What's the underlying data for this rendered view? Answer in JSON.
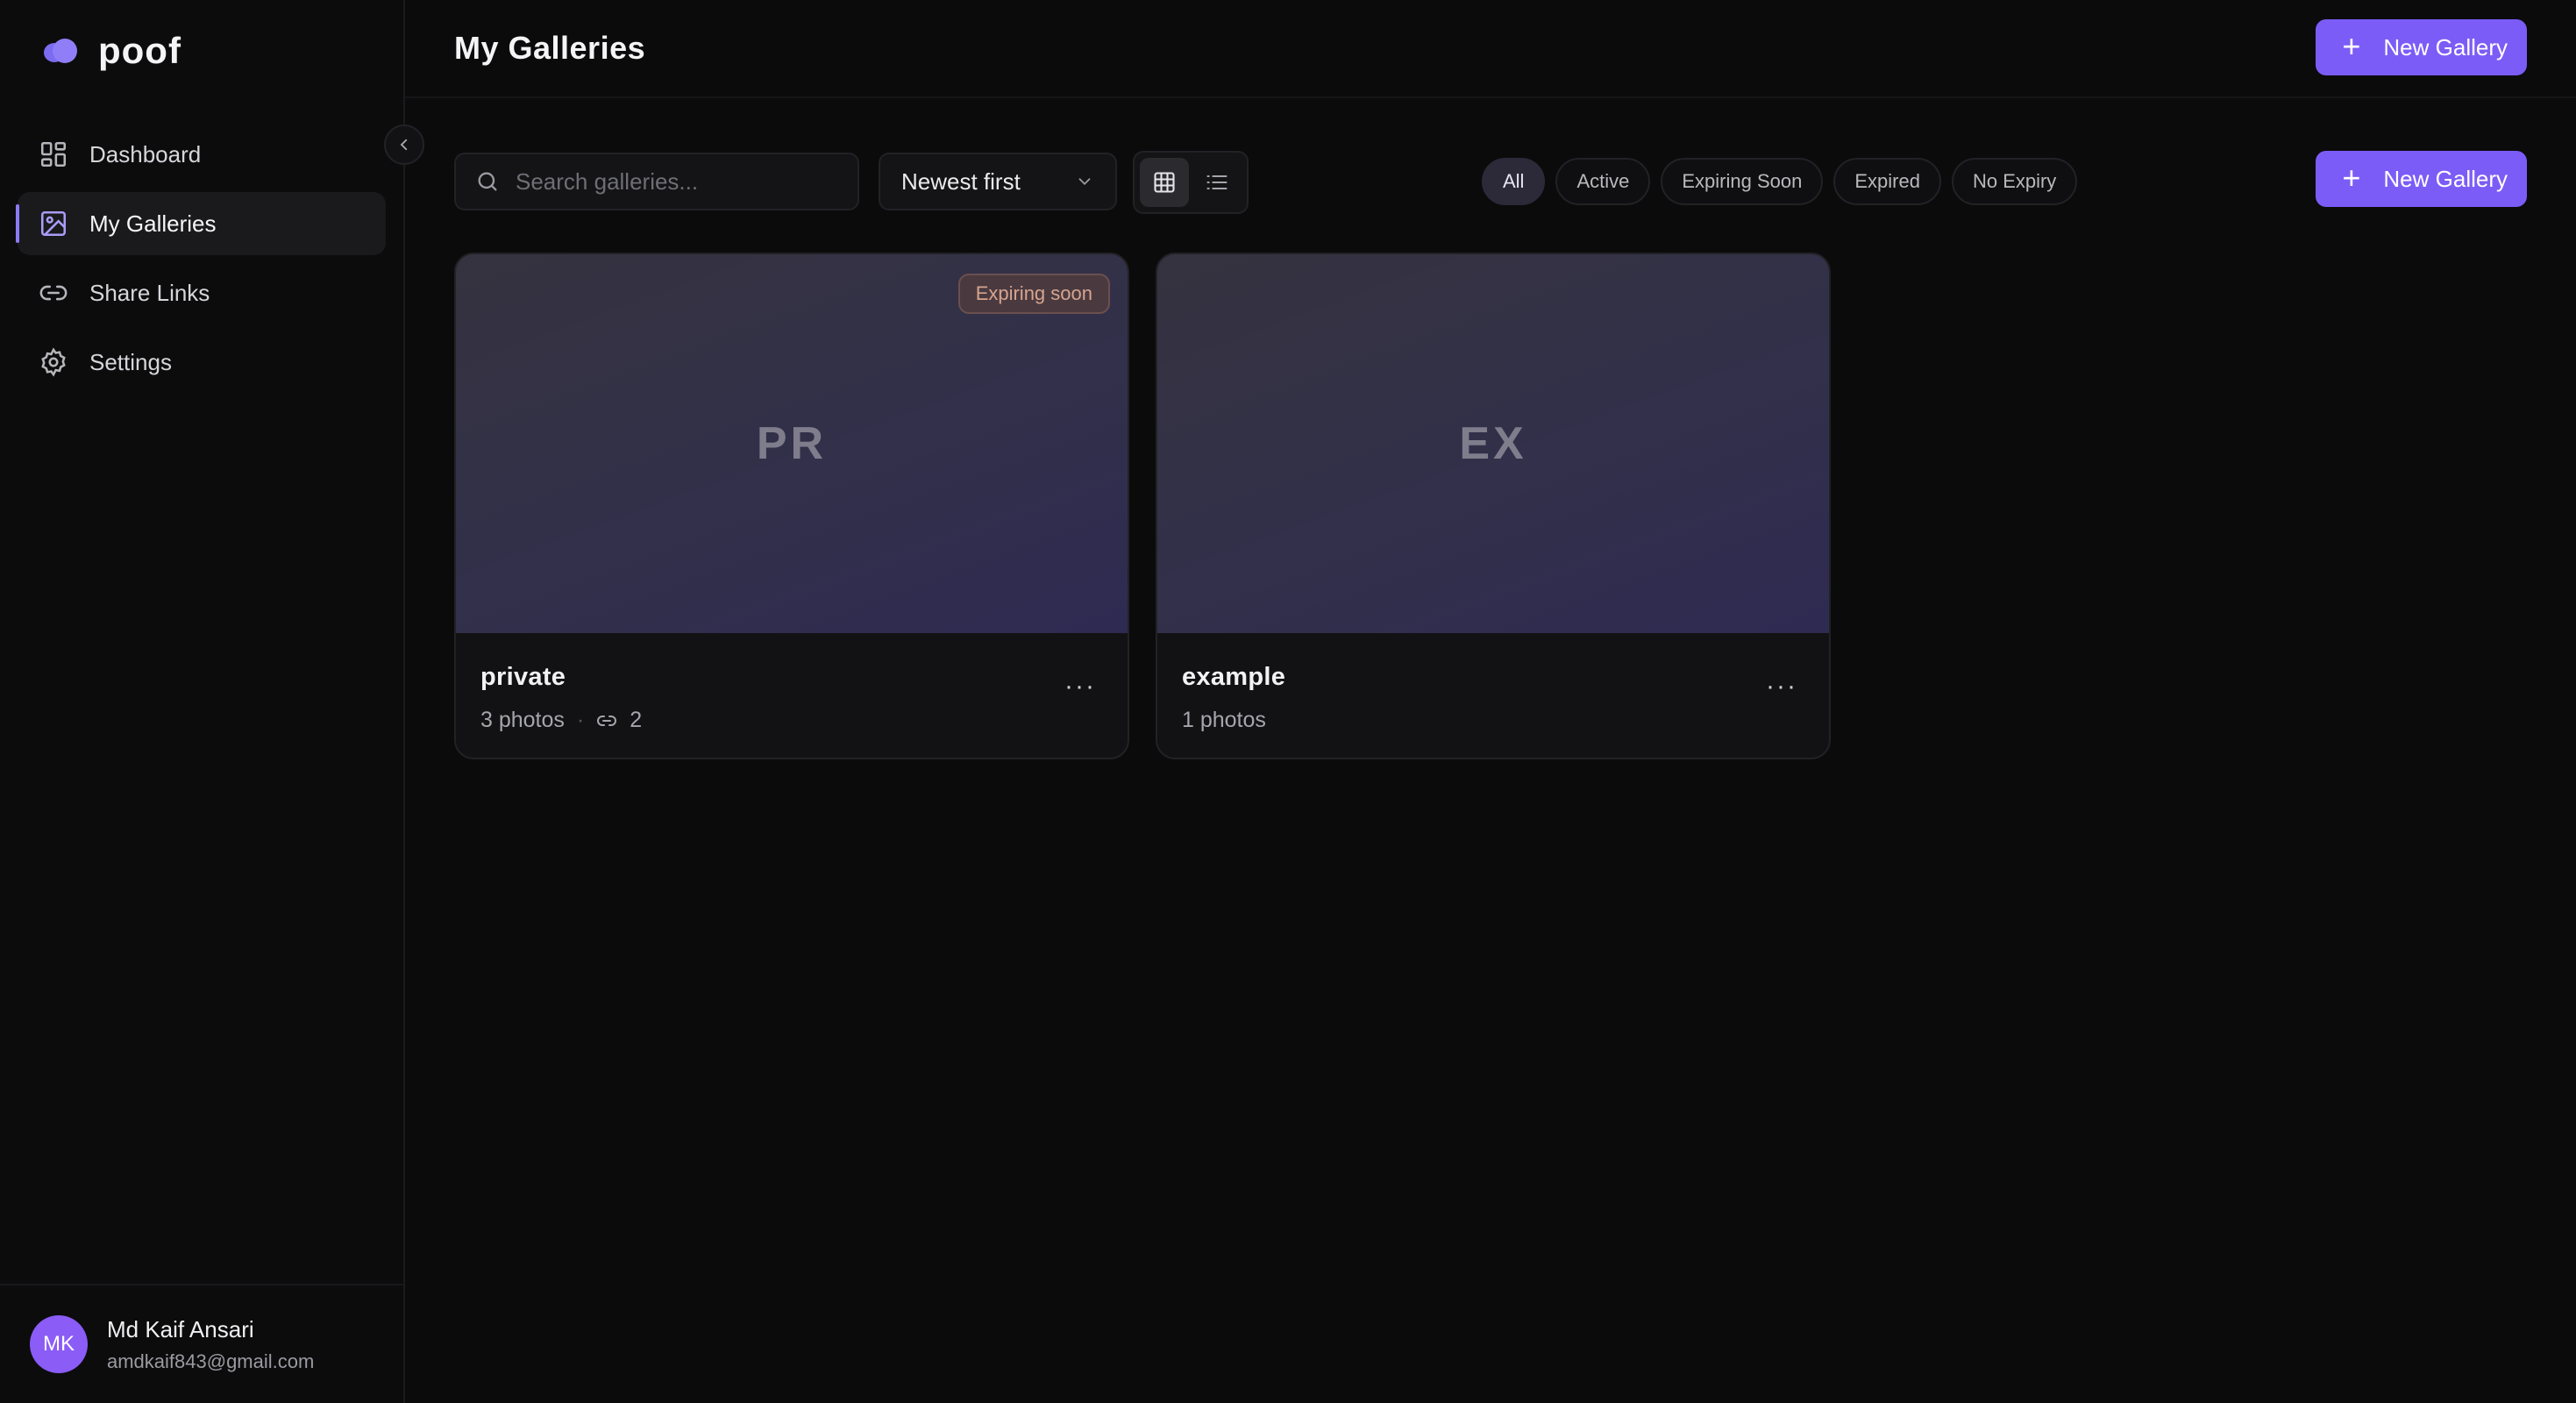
{
  "brand": {
    "name": "poof"
  },
  "sidebar": {
    "items": [
      {
        "label": "Dashboard"
      },
      {
        "label": "My Galleries"
      },
      {
        "label": "Share Links"
      },
      {
        "label": "Settings"
      }
    ]
  },
  "user": {
    "initials": "MK",
    "name": "Md Kaif Ansari",
    "email": "amdkaif843@gmail.com"
  },
  "header": {
    "title": "My Galleries",
    "new_gallery_label": "New Gallery"
  },
  "toolbar": {
    "search_placeholder": "Search galleries...",
    "sort_value": "Newest first",
    "new_gallery_label": "New Gallery",
    "filters": [
      "All",
      "Active",
      "Expiring Soon",
      "Expired",
      "No Expiry"
    ],
    "active_filter": "All"
  },
  "galleries": [
    {
      "initials": "PR",
      "name": "private",
      "photos": "3 photos",
      "links": "2",
      "badge": "Expiring soon"
    },
    {
      "initials": "EX",
      "name": "example",
      "photos": "1 photos"
    }
  ],
  "colors": {
    "accent": "#7c5cf6",
    "background": "#0b0b0c",
    "badge_text": "#d7a48e"
  }
}
